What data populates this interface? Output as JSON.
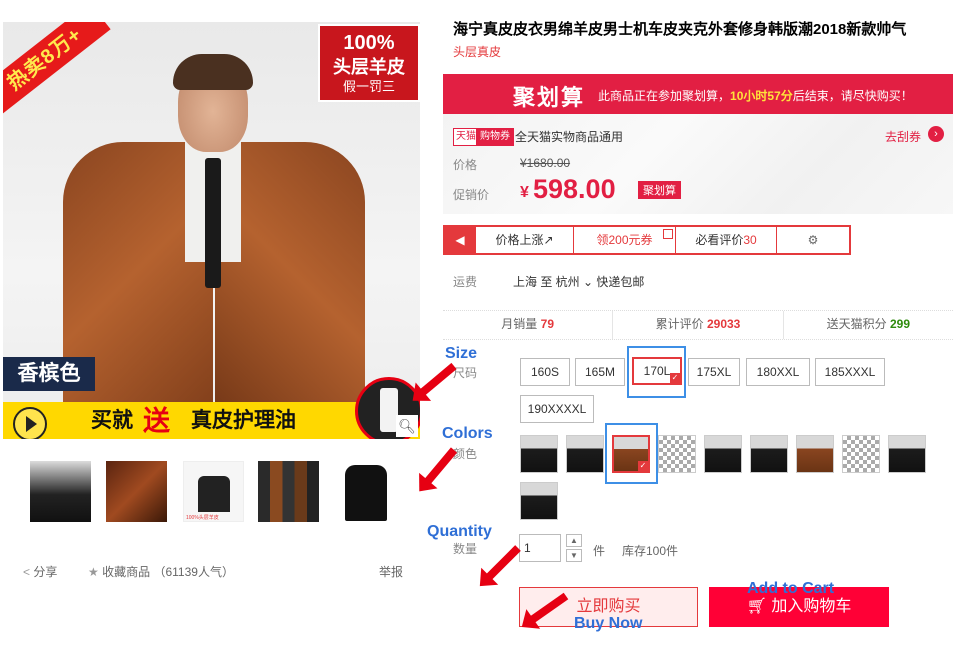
{
  "gallery": {
    "hot_badge": "热卖8万+",
    "quality_line1": "100%",
    "quality_line2": "头层羊皮",
    "quality_line3": "假一罚三",
    "color_tag": "香槟色",
    "promo_part1": "买就",
    "promo_part2": "送",
    "promo_part3": "真皮护理油",
    "thumb_3_caption": "100%头层羊皮"
  },
  "share": {
    "share_label": "分享",
    "favorite_label": "收藏商品",
    "favorite_count": "（61139人气）",
    "report_label": "举报"
  },
  "product": {
    "title": "海宁真皮皮衣男绵羊皮男士机车皮夹克外套修身韩版潮2018新款帅气",
    "subtitle": "头层真皮"
  },
  "juhuasuan": {
    "logo": "聚划算",
    "text_before": "此商品正在参加聚划算，",
    "time_left": "10小时57分",
    "text_after": "后结束，请尽快购买！"
  },
  "pricing": {
    "tmall_tag_a": "天猫",
    "tmall_tag_b": "购物券",
    "coupon_text": "全天猫实物商品通用",
    "coupon_link": "去刮券",
    "coupon_arrow": "›",
    "price_label": "价格",
    "original_price": "¥1680.00",
    "promo_label": "促销价",
    "currency": "¥",
    "promo_price": "598.00",
    "promo_badge": "聚划算"
  },
  "actions": {
    "price_up": "价格上涨↗",
    "coupon": "领200元券",
    "must_see": "必看评价",
    "must_see_count": "30"
  },
  "shipping": {
    "label": "运费",
    "detail": "上海  至 杭州 ⌄  快递包邮"
  },
  "stats": {
    "monthly_label": "月销量",
    "monthly_value": "79",
    "reviews_label": "累计评价",
    "reviews_value": "29033",
    "points_label": "送天猫积分",
    "points_value": "299"
  },
  "options": {
    "size_label": "尺码",
    "sizes": [
      "160S",
      "165M",
      "170L",
      "175XL",
      "180XXL",
      "185XXXL",
      "190XXXXL"
    ],
    "selected_size": "170L",
    "color_label": "颜色",
    "quantity_label": "数量",
    "quantity_value": "1",
    "unit": "件",
    "stock": "库存100件"
  },
  "buttons": {
    "buy_now": "立即购买",
    "add_to_cart": "加入购物车"
  },
  "annotations": {
    "size": "Size",
    "colors": "Colors",
    "quantity": "Quantity",
    "add_to_cart": "Add to Cart",
    "buy_now": "Buy Now"
  },
  "colors": {
    "accent": "#e4393c",
    "juhuasuan": "#e21f43",
    "cart": "#ff0036",
    "annotation": "#2f6fd6",
    "frame": "#3d8fe6"
  }
}
